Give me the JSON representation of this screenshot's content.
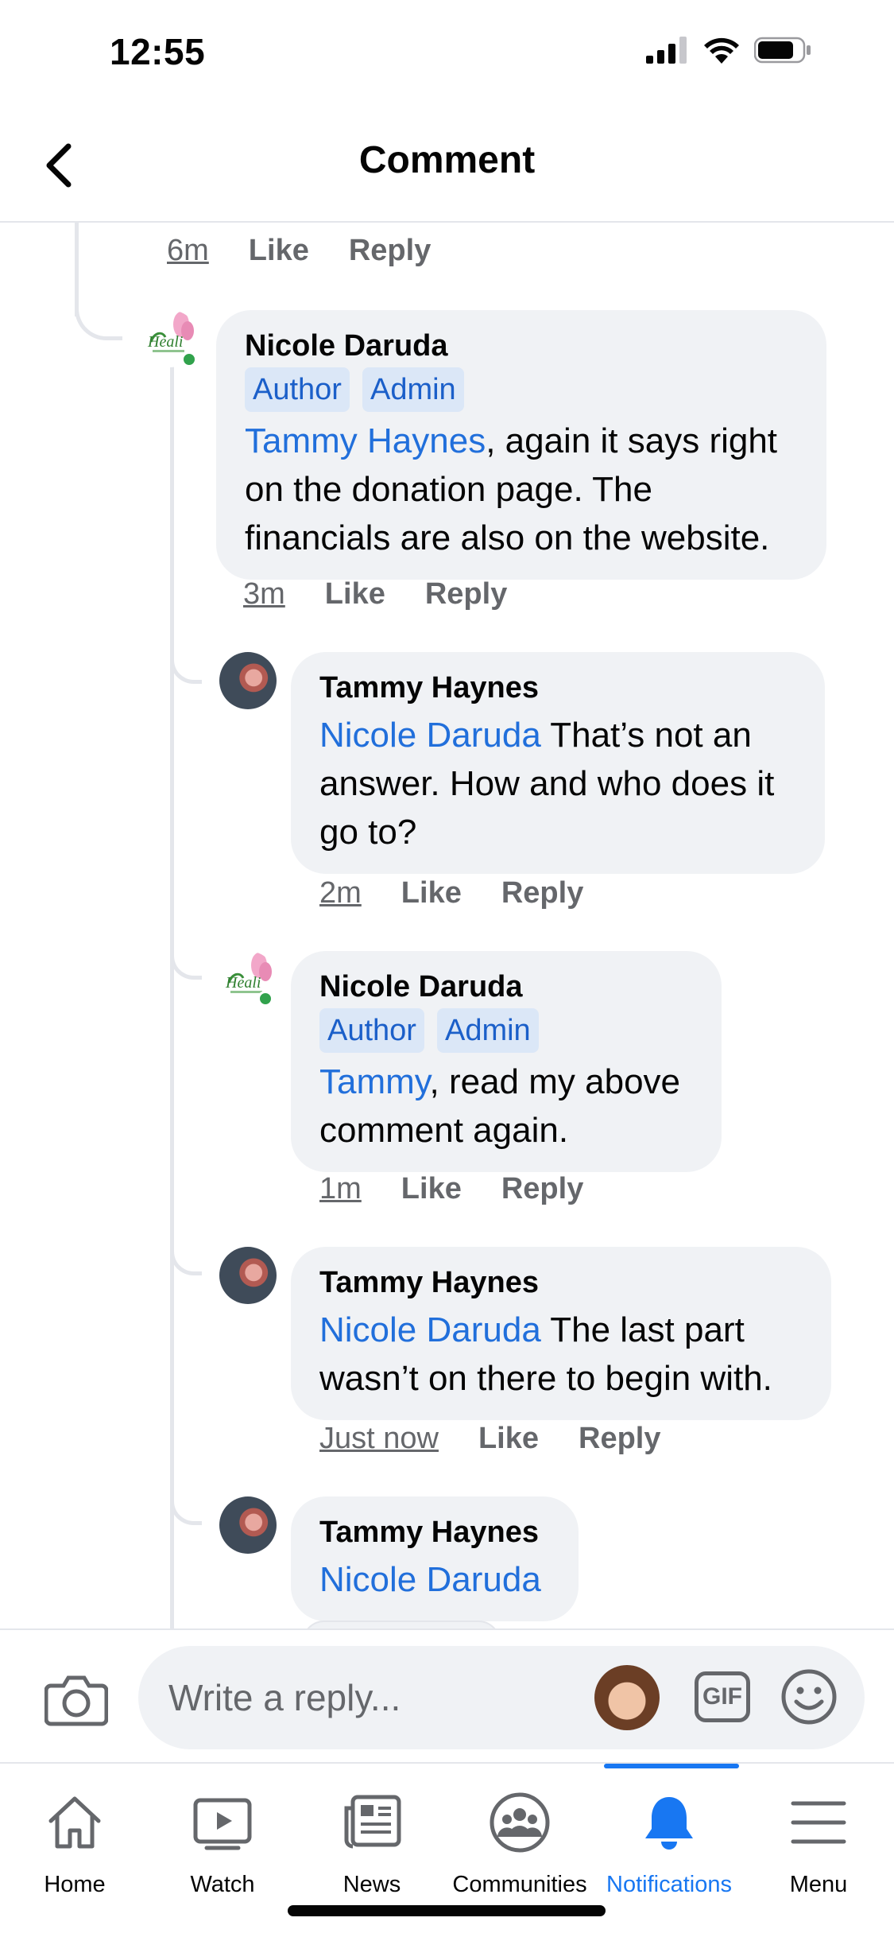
{
  "status_bar": {
    "time": "12:55"
  },
  "header": {
    "title": "Comment"
  },
  "thread": {
    "first_actions": {
      "time": "6m",
      "like": "Like",
      "reply": "Reply"
    },
    "comments": [
      {
        "author": "Nicole Daruda",
        "badges": [
          "Author",
          "Admin"
        ],
        "mention": "Tammy Haynes",
        "text": ", again it says right on the donation page.  The financials are also on the website.",
        "time": "3m",
        "like": "Like",
        "reply": "Reply"
      },
      {
        "author": "Tammy Haynes",
        "mention": "Nicole Daruda",
        "text": " That’s not an answer. How and who does it go to?",
        "time": "2m",
        "like": "Like",
        "reply": "Reply"
      },
      {
        "author": "Nicole Daruda",
        "badges": [
          "Author",
          "Admin"
        ],
        "mention": "Tammy",
        "text": ", read my above comment again.",
        "time": "1m",
        "like": "Like",
        "reply": "Reply"
      },
      {
        "author": "Tammy Haynes",
        "mention": "Nicole Daruda",
        "text": " The last part wasn’t on there to begin with.",
        "time": "Just now",
        "like": "Like",
        "reply": "Reply"
      },
      {
        "author": "Tammy Haynes",
        "mention": "Nicole Daruda"
      }
    ]
  },
  "composer": {
    "placeholder": "Write a reply...",
    "gif_label": "GIF"
  },
  "tabs": [
    {
      "label": "Home",
      "icon": "home-icon"
    },
    {
      "label": "Watch",
      "icon": "watch-icon"
    },
    {
      "label": "News",
      "icon": "news-icon"
    },
    {
      "label": "Communities",
      "icon": "communities-icon"
    },
    {
      "label": "Notifications",
      "icon": "bell-icon",
      "active": true
    },
    {
      "label": "Menu",
      "icon": "menu-icon"
    }
  ],
  "colors": {
    "accent": "#1877f2",
    "mention": "#216fdb",
    "badge_bg": "#dbe7f7",
    "bubble_bg": "#f0f2f5"
  }
}
